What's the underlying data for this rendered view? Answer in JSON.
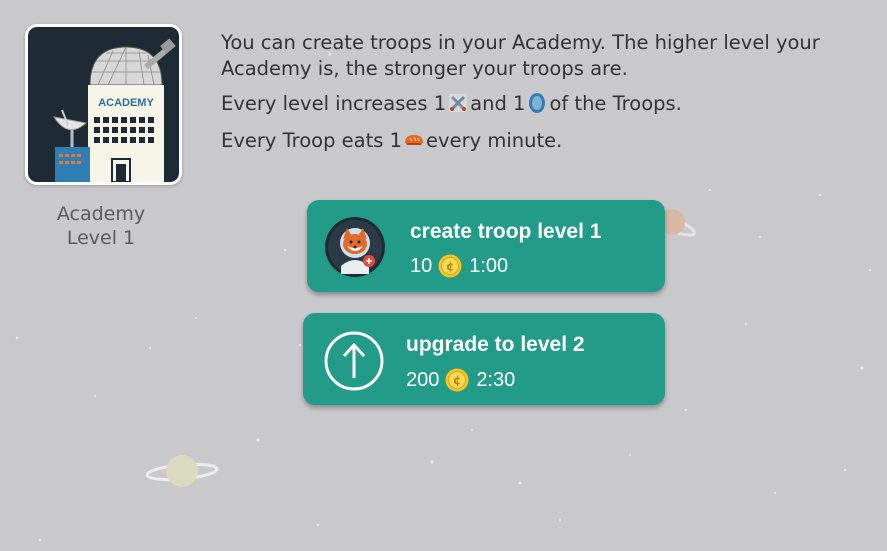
{
  "building": {
    "sign": "ACADEMY",
    "name": "Academy",
    "level_label": "Level 1"
  },
  "info": {
    "line1": "You can create troops in your Academy. The higher level  your Academy is, the stronger your troops are.",
    "line2_a": "Every level increases 1",
    "line2_b": "and 1",
    "line2_c": "of the Troops.",
    "line3_a": "Every Troop eats 1",
    "line3_b": "every minute.",
    "icons": [
      "swords-icon",
      "shield-icon",
      "bread-icon"
    ]
  },
  "actions": {
    "create": {
      "title": "create troop level 1",
      "cost": "10",
      "time": "1:00",
      "icon": "fox-astronaut-avatar"
    },
    "upgrade": {
      "title": "upgrade to level 2",
      "cost": "200",
      "time": "2:30",
      "icon": "arrow-up-circle-icon"
    }
  },
  "colors": {
    "background": "#c9c9cb",
    "button": "#229b88",
    "coin": "#f3c623",
    "card": "#1e2b34"
  }
}
